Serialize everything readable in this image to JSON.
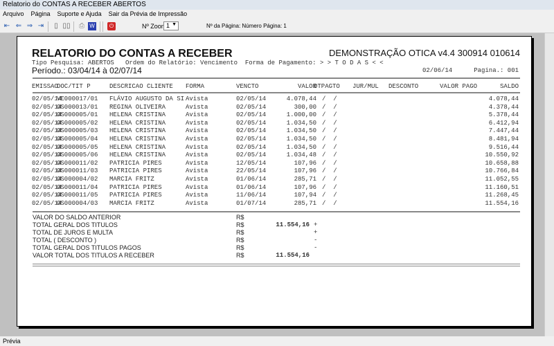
{
  "window": {
    "title": "Relatorio do CONTAS A RECEBER ABERTOS"
  },
  "menu": [
    "Arquivo",
    "Página",
    "Suporte e Ajuda",
    "Sair da Prévia de Impressão"
  ],
  "toolbar": {
    "zoom_label": "Nº Zoom",
    "zoom_value": "1",
    "page_label": "Nº da Página: Número Página: 1"
  },
  "report": {
    "title": "RELATORIO DO CONTAS A RECEBER",
    "company": "DEMONSTRAÇÃO OTICA v4.4 300914 010614",
    "filters": "Tipo Pesquisa: ABERTOS   Ordem do Relatório: Vencimento  Forma de Pagamento: > > T O D A S < <",
    "period": "Período.: 03/04/14 à 02/07/14",
    "date": "02/06/14",
    "page": "Pagina.: 001",
    "columns": {
      "emissao": "EMISSAO",
      "doc": "DOC/TIT P",
      "descricao": "DESCRICAO CLIENTE",
      "forma": "FORMA",
      "vencto": "VENCTO",
      "valor": "VALOR",
      "dtpagto": "DTPAGTO",
      "jurmul": "JUR/MUL",
      "desconto": "DESCONTO",
      "valorpago": "VALOR PAGO",
      "saldo": "SALDO"
    },
    "rows": [
      [
        "02/05/14",
        "VE000017/01",
        "FLÁVIO AUGUSTO DA SI",
        "Avista",
        "02/05/14",
        "4.078,44",
        "/  /",
        "4.078,44"
      ],
      [
        "02/05/14",
        "OS000013/01",
        "REGINA OLIVEIRA",
        "Avista",
        "02/05/14",
        "300,00",
        "/  /",
        "4.378,44"
      ],
      [
        "02/05/14",
        "OS000005/01",
        "HELENA CRISTINA",
        "Avista",
        "02/05/14",
        "1.000,00",
        "/  /",
        "5.378,44"
      ],
      [
        "02/05/14",
        "OS000005/02",
        "HELENA CRISTINA",
        "Avista",
        "02/05/14",
        "1.034,50",
        "/  /",
        "6.412,94"
      ],
      [
        "02/05/14",
        "OS000005/03",
        "HELENA CRISTINA",
        "Avista",
        "02/05/14",
        "1.034,50",
        "/  /",
        "7.447,44"
      ],
      [
        "02/05/14",
        "OS000005/04",
        "HELENA CRISTINA",
        "Avista",
        "02/05/14",
        "1.034,50",
        "/  /",
        "8.481,94"
      ],
      [
        "02/05/14",
        "OS000005/05",
        "HELENA CRISTINA",
        "Avista",
        "02/05/14",
        "1.034,50",
        "/  /",
        "9.516,44"
      ],
      [
        "02/05/14",
        "OS000005/06",
        "HELENA CRISTINA",
        "Avista",
        "02/05/14",
        "1.034,48",
        "/  /",
        "10.550,92"
      ],
      [
        "02/05/14",
        "OS000011/02",
        "PATRICIA PIRES",
        "Avista",
        "12/05/14",
        "107,96",
        "/  /",
        "10.658,88"
      ],
      [
        "02/05/14",
        "OS000011/03",
        "PATRICIA PIRES",
        "Avista",
        "22/05/14",
        "107,96",
        "/  /",
        "10.766,84"
      ],
      [
        "02/05/14",
        "OS000004/02",
        "MARCIA FRITZ",
        "Avista",
        "01/06/14",
        "285,71",
        "/  /",
        "11.052,55"
      ],
      [
        "02/05/14",
        "OS000011/04",
        "PATRICIA PIRES",
        "Avista",
        "01/06/14",
        "107,96",
        "/  /",
        "11.160,51"
      ],
      [
        "02/05/14",
        "OS000011/05",
        "PATRICIA PIRES",
        "Avista",
        "11/06/14",
        "107,94",
        "/  /",
        "11.268,45"
      ],
      [
        "02/05/14",
        "OS000004/03",
        "MARCIA FRITZ",
        "Avista",
        "01/07/14",
        "285,71",
        "/  /",
        "11.554,16"
      ]
    ],
    "totals": [
      {
        "label": "VALOR DO SALDO ANTERIOR",
        "currency": "R$",
        "value": "",
        "sign": ""
      },
      {
        "label": "TOTAL GERAL DOS TITULOS",
        "currency": "R$",
        "value": "11.554,16",
        "sign": "+"
      },
      {
        "label": "TOTAL DE JUROS E MULTA",
        "currency": "R$",
        "value": "",
        "sign": "+"
      },
      {
        "label": "TOTAL ( DESCONTO )",
        "currency": "R$",
        "value": "",
        "sign": "-"
      },
      {
        "label": "TOTAL GERAL DOS TITULOS PAGOS",
        "currency": "R$",
        "value": "",
        "sign": "-"
      },
      {
        "label": "VALOR TOTAL DOS TITULOS A RECEBER",
        "currency": "R$",
        "value": "11.554,16",
        "sign": ""
      }
    ]
  },
  "status": "Prévia"
}
